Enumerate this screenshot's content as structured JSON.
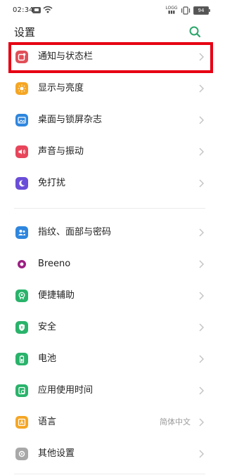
{
  "status_bar": {
    "time": "02:34",
    "signal_label": "LOGG\n•ॢLG",
    "battery": "94"
  },
  "header": {
    "title": "设置"
  },
  "settings": {
    "items": [
      {
        "id": "notification",
        "label": "通知与状态栏",
        "color": "#e04e57",
        "icon": "notification-icon"
      },
      {
        "id": "display",
        "label": "显示与亮度",
        "color": "#f5a623",
        "icon": "sun-icon"
      },
      {
        "id": "wallpaper",
        "label": "桌面与锁屏杂志",
        "color": "#2e86de",
        "icon": "image-icon"
      },
      {
        "id": "sound",
        "label": "声音与振动",
        "color": "#e8455b",
        "icon": "speaker-icon"
      },
      {
        "id": "dnd",
        "label": "免打扰",
        "color": "#6a4dd8",
        "icon": "moon-icon"
      },
      {
        "id": "security-biometrics",
        "label": "指纹、面部与密码",
        "color": "#2e86de",
        "icon": "fingerprint-icon"
      },
      {
        "id": "breeno",
        "label": "Breeno",
        "color": "#9b1f82",
        "icon": "breeno-icon"
      },
      {
        "id": "accessibility",
        "label": "便捷辅助",
        "color": "#29b36b",
        "icon": "hand-icon"
      },
      {
        "id": "security",
        "label": "安全",
        "color": "#29b36b",
        "icon": "shield-icon"
      },
      {
        "id": "battery",
        "label": "电池",
        "color": "#29b36b",
        "icon": "battery-icon"
      },
      {
        "id": "app-usage",
        "label": "应用使用时间",
        "color": "#29b36b",
        "icon": "clock-icon"
      },
      {
        "id": "language",
        "label": "语言",
        "value": "简体中文",
        "color": "#f5a623",
        "icon": "language-icon"
      },
      {
        "id": "other",
        "label": "其他设置",
        "color": "#9a9a9a",
        "icon": "more-icon"
      }
    ]
  }
}
